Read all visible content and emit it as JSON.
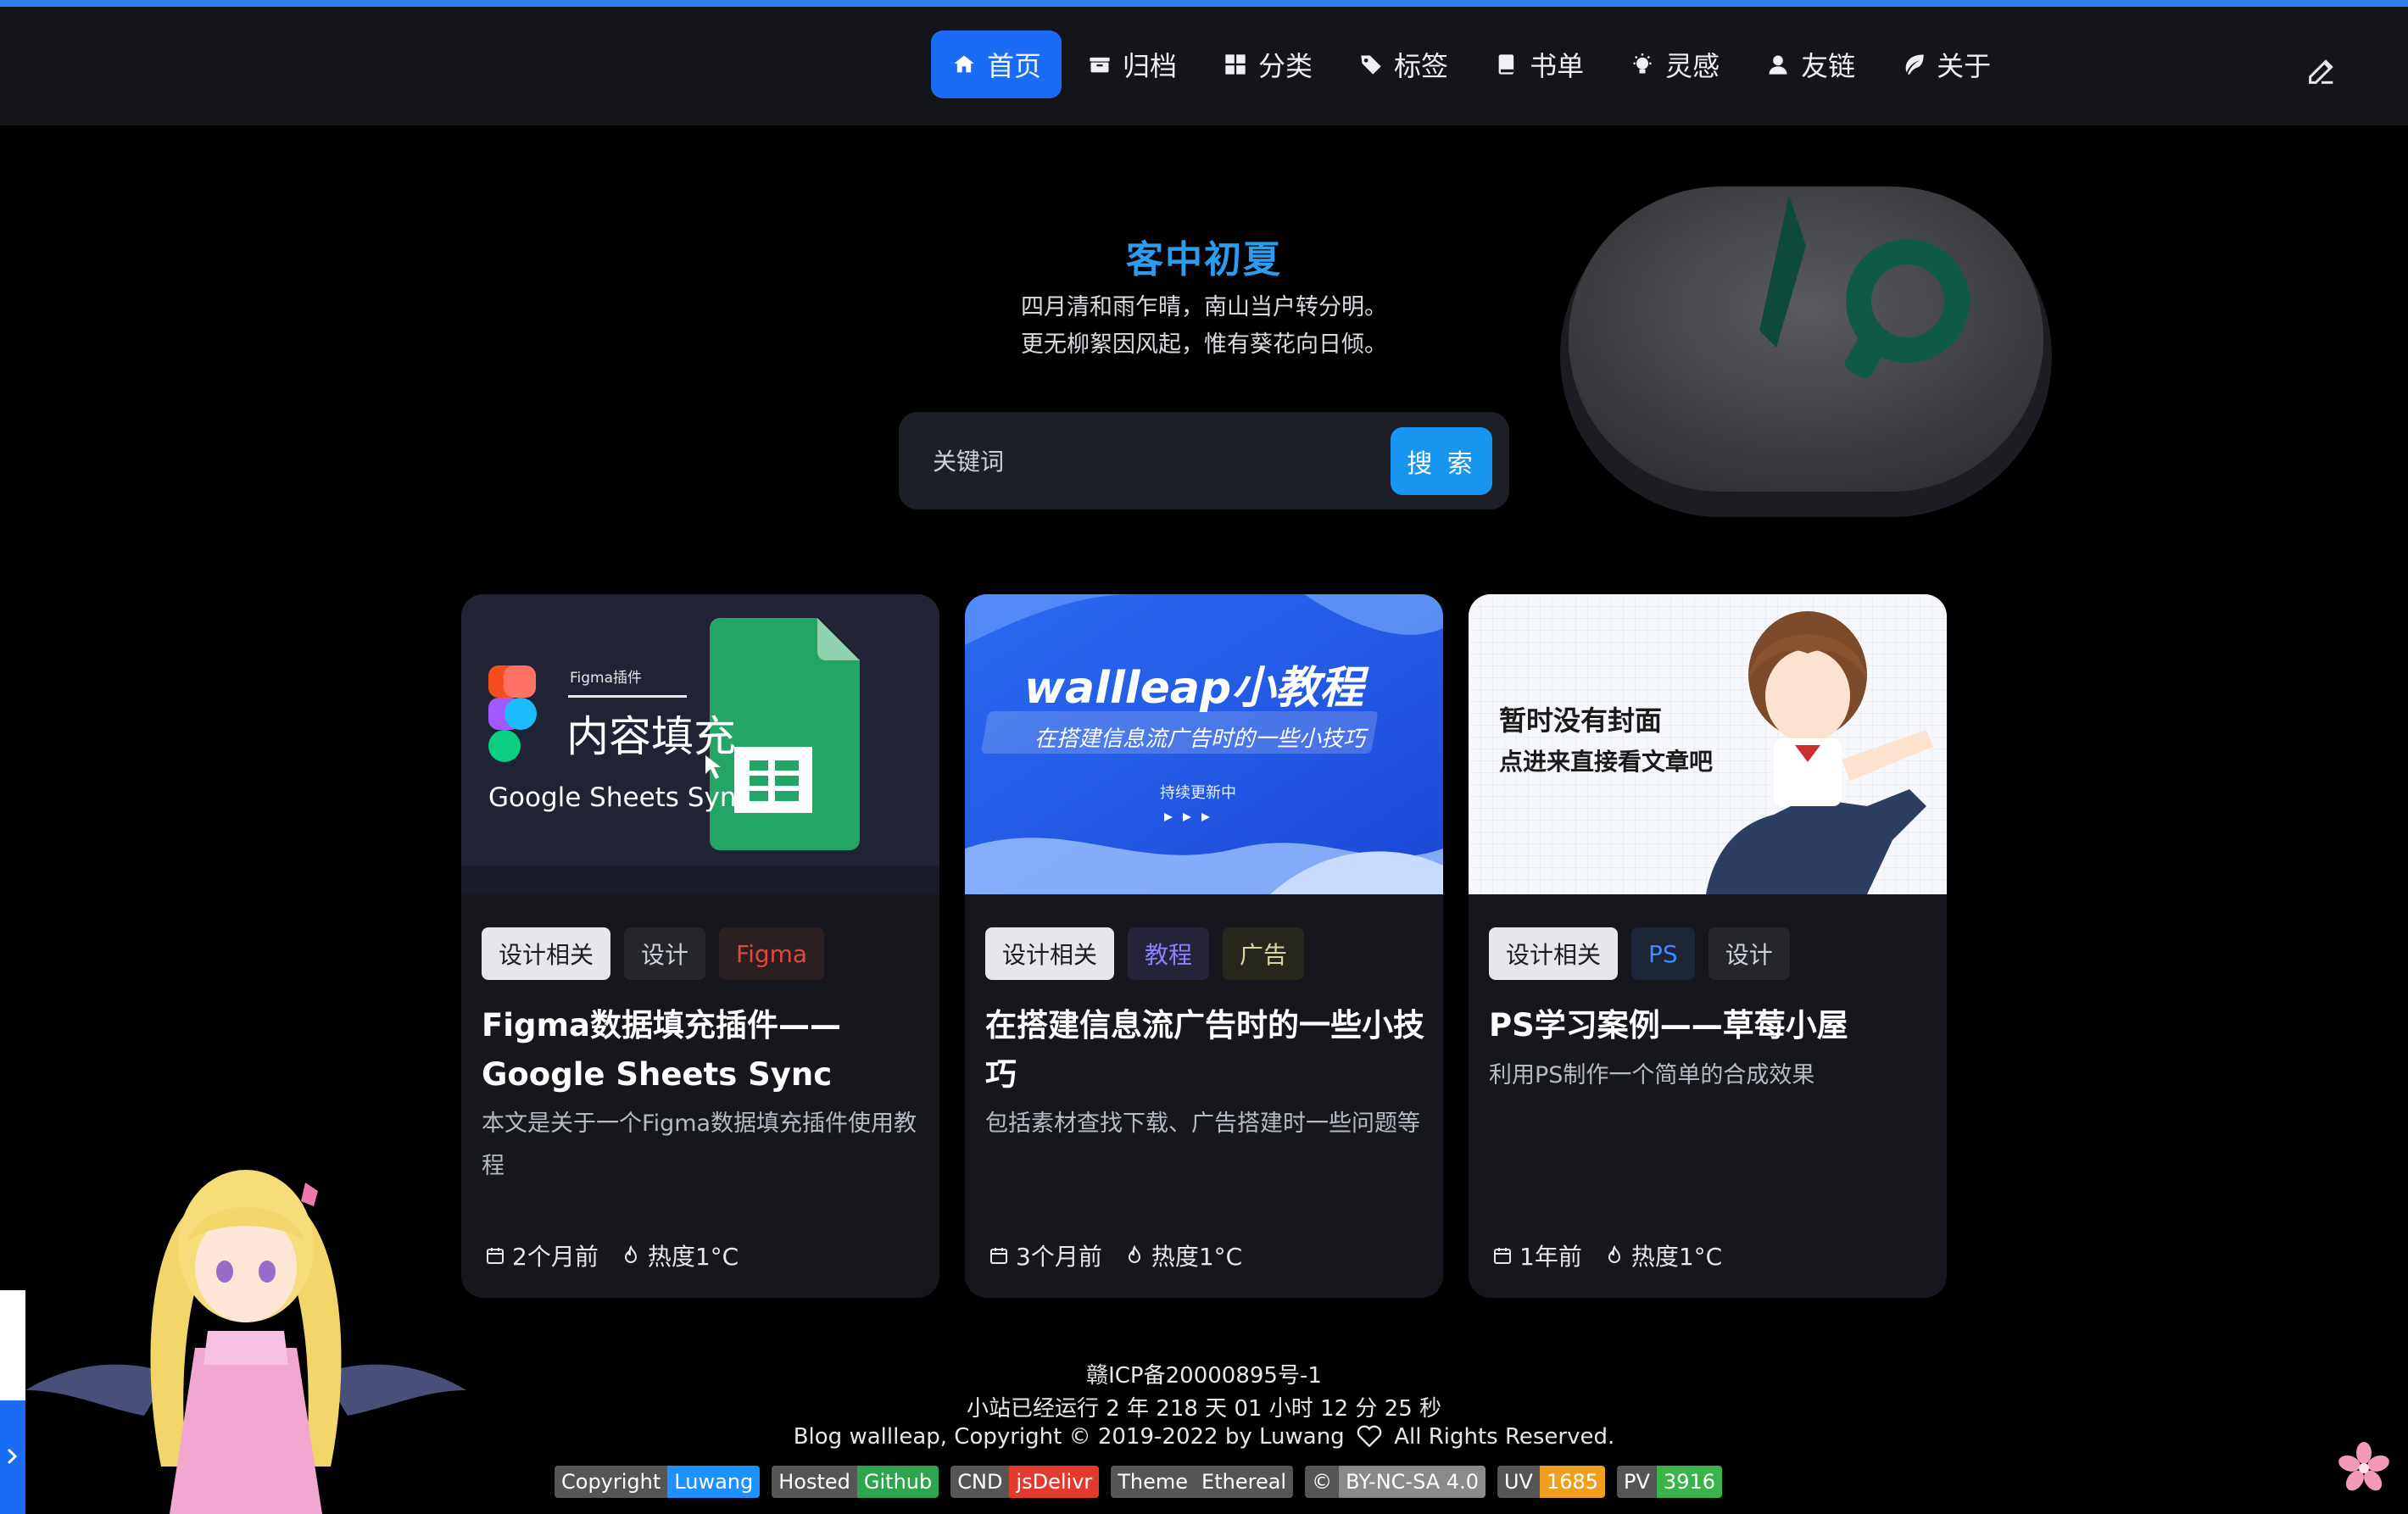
{
  "nav": {
    "items": [
      {
        "label": "首页",
        "icon": "home-icon",
        "active": true
      },
      {
        "label": "归档",
        "icon": "archive-icon"
      },
      {
        "label": "分类",
        "icon": "grid-icon"
      },
      {
        "label": "标签",
        "icon": "tag-icon"
      },
      {
        "label": "书单",
        "icon": "book-icon"
      },
      {
        "label": "灵感",
        "icon": "lightbulb-icon"
      },
      {
        "label": "友链",
        "icon": "user-icon"
      },
      {
        "label": "关于",
        "icon": "leaf-icon"
      }
    ]
  },
  "hero": {
    "title": "客中初夏",
    "line1": "四月清和雨乍晴，南山当户转分明。",
    "line2": "更无柳絮因风起，惟有葵花向日倾。"
  },
  "search": {
    "placeholder": "关键词",
    "button_label": "搜 索"
  },
  "cards": [
    {
      "cover_small": "Figma插件",
      "cover_big": "内容填充",
      "cover_sub": "Google Sheets Sync",
      "tags": [
        "设计相关",
        "设计",
        "Figma"
      ],
      "title": "Figma数据填充插件——Google Sheets Sync",
      "desc": "本文是关于一个Figma数据填充插件使用教程",
      "time": "2个月前",
      "heat": "热度1°C"
    },
    {
      "cover_big": "wallleap小教程",
      "cover_sub": "在搭建信息流广告时的一些小技巧",
      "cover_small": "持续更新中",
      "tags": [
        "设计相关",
        "教程",
        "广告"
      ],
      "title": "在搭建信息流广告时的一些小技巧",
      "desc": "包括素材查找下载、广告搭建时一些问题等",
      "time": "3个月前",
      "heat": "热度1°C"
    },
    {
      "cover_line1": "暂时没有封面",
      "cover_line2": "点进来直接看文章吧",
      "tags": [
        "设计相关",
        "PS",
        "设计"
      ],
      "title": "PS学习案例——草莓小屋",
      "desc": "利用PS制作一个简单的合成效果",
      "time": "1年前",
      "heat": "热度1°C"
    }
  ],
  "footer": {
    "icp": "赣ICP备20000895号-1",
    "runtime": "小站已经运行 2 年 218 天 01 小时 12 分 25 秒",
    "copyright_left": "Blog wallleap, Copyright © 2019-2022 by Luwang",
    "copyright_right": "All Rights Reserved.",
    "badges": [
      {
        "left": "Copyright",
        "right": "Luwang",
        "color": "#1e90ff"
      },
      {
        "left": "Hosted",
        "right": "Github",
        "color": "#2ea44f"
      },
      {
        "left": "CND",
        "right": "jsDelivr",
        "color": "#e23b2e"
      },
      {
        "left": "Theme",
        "right": "Ethereal",
        "color": "#555555"
      },
      {
        "left": "©",
        "right": "BY-NC-SA 4.0",
        "color": "#8a8a8a"
      },
      {
        "left": "UV",
        "right": "1685",
        "color": "#f0a020"
      },
      {
        "left": "PV",
        "right": "3916",
        "color": "#3cb34a"
      }
    ]
  },
  "colors": {
    "accent": "#1a6cf6",
    "hero_title": "#2b9cf0",
    "card_bg": "#16171c"
  }
}
